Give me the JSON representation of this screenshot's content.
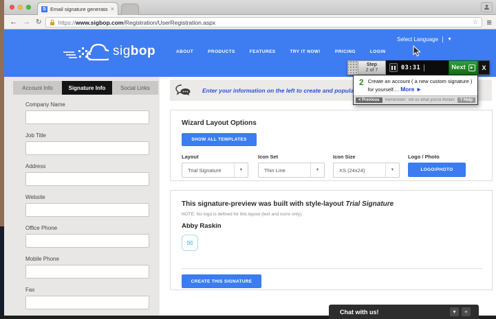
{
  "colors": {
    "header_blue": "#3e7cf1",
    "accent_blue": "#3b7cf0",
    "next_green": "#2fa03a",
    "active_tab_black": "#141414"
  },
  "browser": {
    "tab_title": "Email signature generator e",
    "tab_close": "×",
    "favicon_letter": "S",
    "back": "←",
    "forward": "→",
    "reload": "↻",
    "star": "☆",
    "menu": "≡",
    "url": {
      "scheme": "https://",
      "domain": "www.sigbop.com",
      "path": "/Registration/UserRegistration.aspx"
    }
  },
  "header": {
    "brand_light": "sig",
    "brand_bold": "bop",
    "nav": [
      "ABOUT",
      "PRODUCTS",
      "FEATURES",
      "TRY IT NOW!",
      "PRICING",
      "LOGIN"
    ],
    "language_label": "Select Language",
    "language_arrow": "▼"
  },
  "tutorial": {
    "step_word": "Step",
    "step_count": "2 of 7",
    "timer": "03:31",
    "next_label": "Next",
    "play_glyph": "▶",
    "close_label": "X",
    "step_number": "2",
    "description": "Create an account ( a new custom signature ) for yourself....",
    "more_label": "More ►",
    "previous_label": "< Previous",
    "reminder": "Remember: Tell us what you're thinking",
    "help_label": "? Help"
  },
  "sidebar": {
    "tabs": [
      {
        "label": "Account Info"
      },
      {
        "label": "Signature Info"
      },
      {
        "label": "Social Links"
      }
    ],
    "fields": [
      "Company Name",
      "Job Title",
      "Address",
      "Website",
      "Office Phone",
      "Mobile Phone",
      "Fax"
    ]
  },
  "main": {
    "banner_text": "Enter your information on the left to create and populate your",
    "wizard": {
      "title": "Wizard Layout Options",
      "show_all_label": "SHOW ALL TEMPLATES",
      "controls": [
        {
          "label": "Layout",
          "value": "Trial Signature"
        },
        {
          "label": "Icon Set",
          "value": "Thin Line"
        },
        {
          "label": "Icon Size",
          "value": "XS (24x24)"
        },
        {
          "label": "Logo / Photo",
          "value": "LOGO/PHOTO"
        }
      ],
      "select_arrow": "▼"
    },
    "preview": {
      "title_prefix": "This signature-preview was built with style-layout ",
      "title_style_name": "Trial Signature",
      "note": "NOTE: No logo is defined for this layout (text and icons only).",
      "person_name": "Abby Raskin",
      "envelope_glyph": "✉"
    },
    "create_button": "CREATE THIS SIGNATURE"
  },
  "chat": {
    "label": "Chat with us!",
    "collapse_glyph": "▾",
    "expand_glyph": "+"
  }
}
